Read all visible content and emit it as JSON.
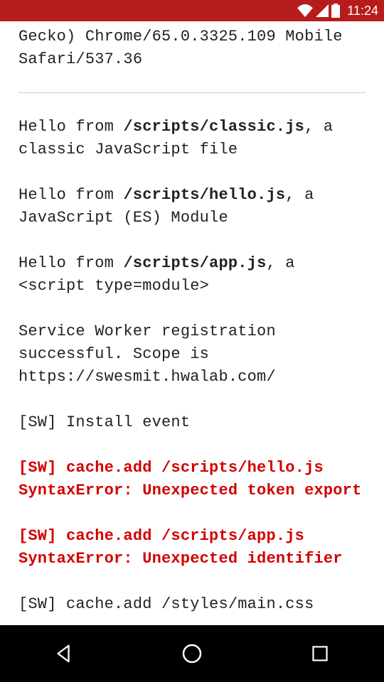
{
  "statusbar": {
    "time": "11:24"
  },
  "log": {
    "ua": "Gecko) Chrome/65.0.3325.109 Mobile Safari/537.36",
    "e1_pre": "Hello from ",
    "e1_path": "/scripts/classic.js",
    "e1_post": ", a classic JavaScript file",
    "e2_pre": "Hello from ",
    "e2_path": "/scripts/hello.js",
    "e2_post": ", a JavaScript (ES) Module",
    "e3_pre": "Hello from ",
    "e3_path": "/scripts/app.js",
    "e3_post": ", a <script type=module>",
    "e4": "Service Worker registration successful. Scope is https://swesmit.hwalab.com/",
    "e5": "[SW] Install event",
    "e6": "[SW] cache.add /scripts/hello.js SyntaxError: Unexpected token export",
    "e7": "[SW] cache.add /scripts/app.js SyntaxError: Unexpected identifier",
    "e8": "[SW] cache.add /styles/main.css"
  }
}
